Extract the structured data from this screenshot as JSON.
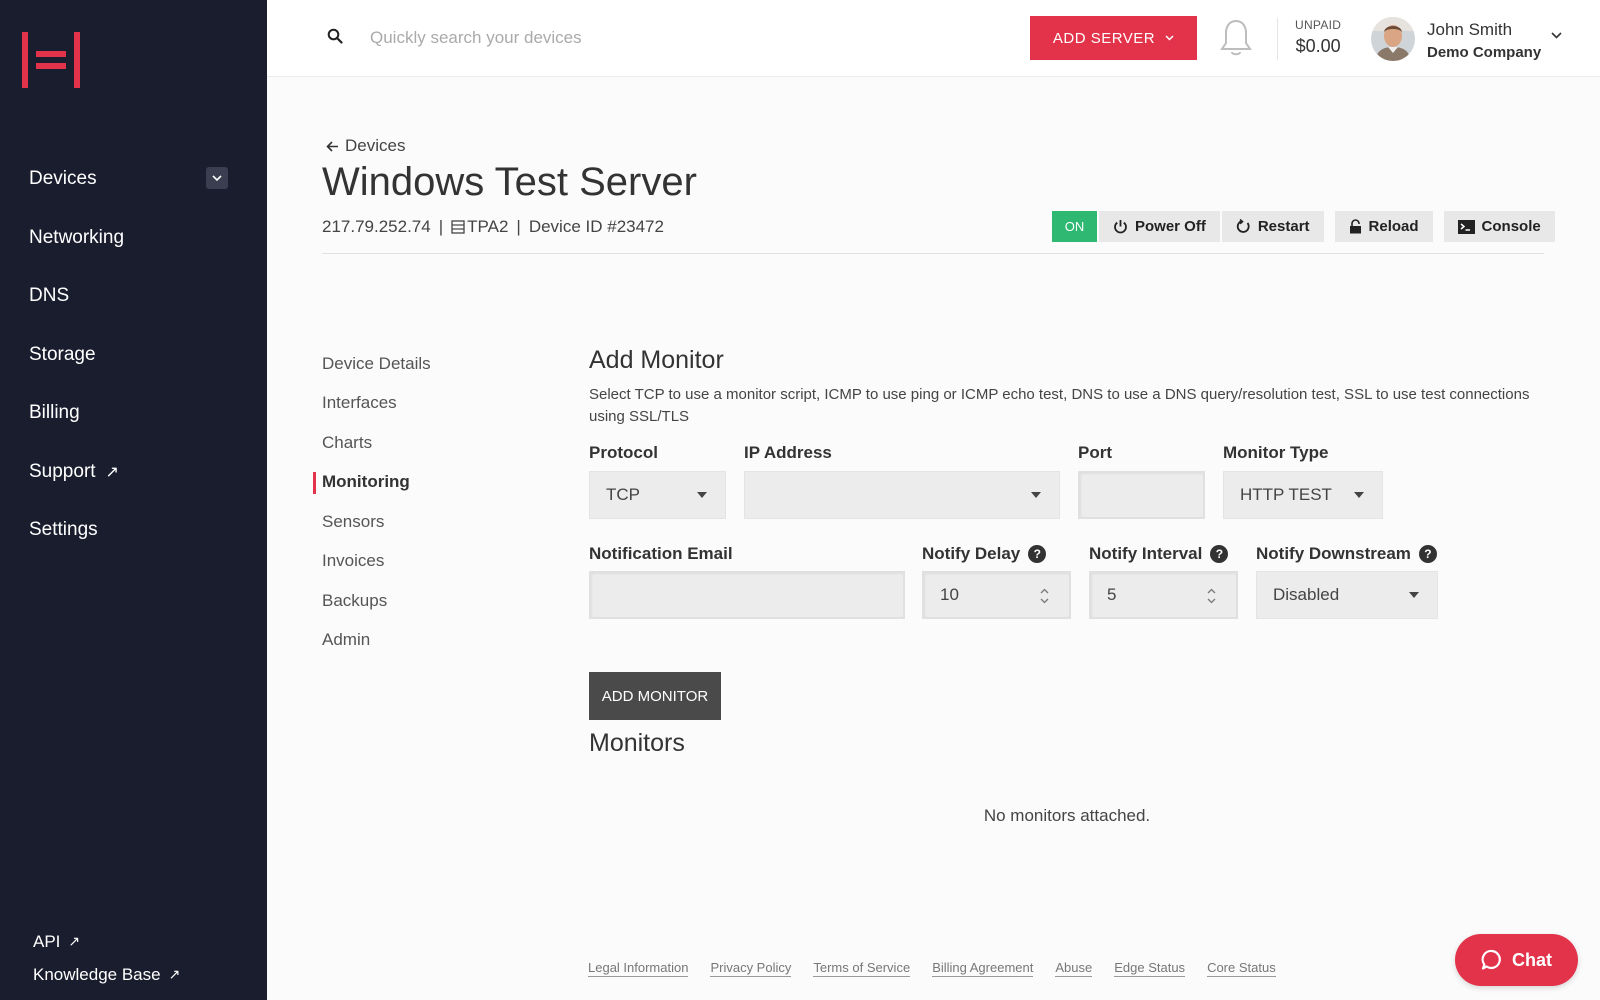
{
  "colors": {
    "brand_red": "#e2334a",
    "sidebar_bg": "#1a1d2e",
    "on_green": "#2eb872"
  },
  "sidebar": {
    "items": [
      {
        "label": "Devices",
        "has_caret": true
      },
      {
        "label": "Networking"
      },
      {
        "label": "DNS"
      },
      {
        "label": "Storage"
      },
      {
        "label": "Billing"
      },
      {
        "label": "Support",
        "external": true
      },
      {
        "label": "Settings"
      }
    ],
    "bottom_links": [
      {
        "label": "API"
      },
      {
        "label": "Knowledge Base"
      }
    ]
  },
  "header": {
    "search_placeholder": "Quickly search your devices",
    "add_server_label": "ADD SERVER",
    "unpaid_label": "UNPAID",
    "unpaid_amount": "$0.00",
    "user_name": "John Smith",
    "user_company": "Demo Company"
  },
  "device": {
    "back_label": "Devices",
    "title": "Windows Test Server",
    "ip": "217.79.252.74",
    "location": "TPA2",
    "device_id": "Device ID #23472",
    "status": "ON",
    "actions": {
      "power_off": "Power Off",
      "restart": "Restart",
      "reload": "Reload",
      "console": "Console"
    }
  },
  "subnav": [
    {
      "label": "Device Details"
    },
    {
      "label": "Interfaces"
    },
    {
      "label": "Charts"
    },
    {
      "label": "Monitoring",
      "active": true
    },
    {
      "label": "Sensors"
    },
    {
      "label": "Invoices"
    },
    {
      "label": "Backups"
    },
    {
      "label": "Admin"
    }
  ],
  "add_monitor": {
    "title": "Add Monitor",
    "description": "Select TCP to use a monitor script, ICMP to use ping or ICMP echo test, DNS to use a DNS query/resolution test, SSL to use test connections using SSL/TLS",
    "labels": {
      "protocol": "Protocol",
      "ip_address": "IP Address",
      "port": "Port",
      "monitor_type": "Monitor Type",
      "notification_email": "Notification Email",
      "notify_delay": "Notify Delay",
      "notify_interval": "Notify Interval",
      "notify_downstream": "Notify Downstream"
    },
    "values": {
      "protocol": "TCP",
      "ip_address": "",
      "port": "",
      "monitor_type": "HTTP TEST",
      "notification_email": "",
      "notify_delay": "10",
      "notify_interval": "5",
      "notify_downstream": "Disabled"
    },
    "submit_label": "ADD MONITOR"
  },
  "monitors": {
    "title": "Monitors",
    "empty_message": "No monitors attached."
  },
  "footer": {
    "links": [
      "Legal Information",
      "Privacy Policy",
      "Terms of Service",
      "Billing Agreement",
      "Abuse",
      "Edge Status",
      "Core Status"
    ]
  },
  "chat": {
    "label": "Chat"
  }
}
